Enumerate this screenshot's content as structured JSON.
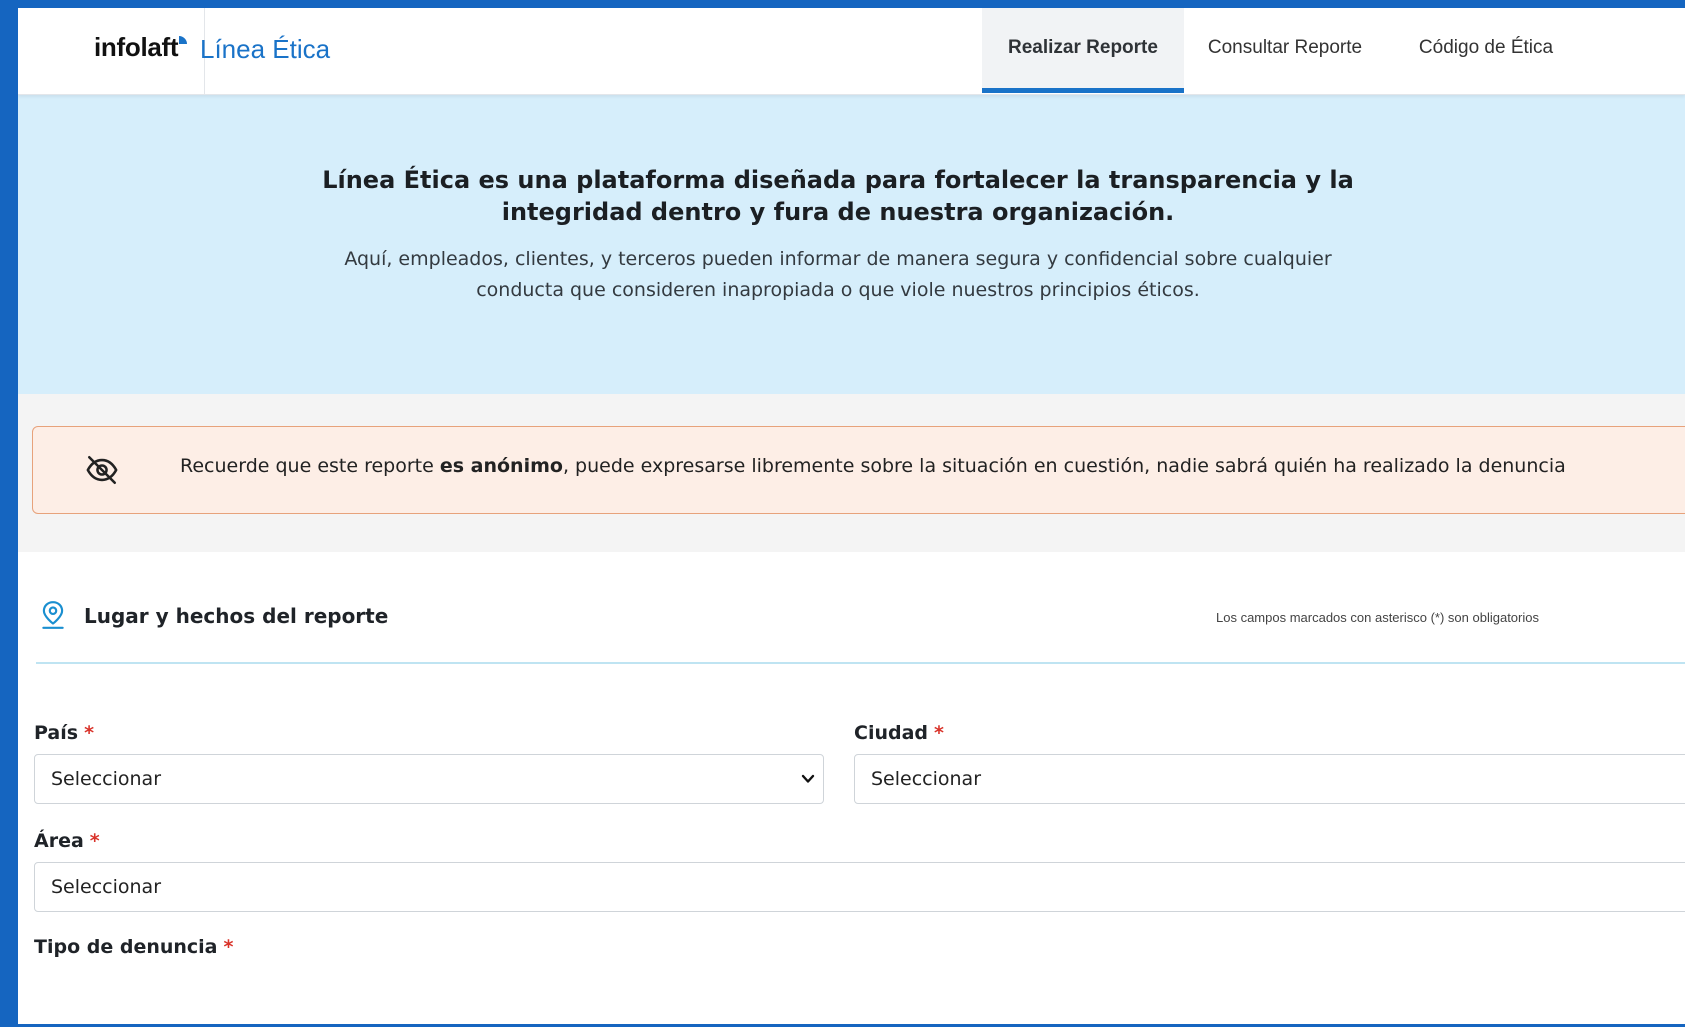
{
  "header": {
    "logo_text": "infolaft",
    "app_title": "Línea Ética",
    "tabs": [
      {
        "label": "Realizar Reporte",
        "active": true
      },
      {
        "label": "Consultar Reporte",
        "active": false
      },
      {
        "label": "Código de Ética",
        "active": false
      }
    ]
  },
  "hero": {
    "title": "Línea Ética es una plataforma diseñada para fortalecer la transparencia y la integridad dentro y fura de nuestra organización.",
    "subtitle": "Aquí, empleados, clientes, y terceros pueden informar de manera segura y confidencial sobre cualquier conducta que consideren inapropiada o que viole nuestros principios éticos."
  },
  "alert": {
    "icon": "eye-off-icon",
    "text_before": "Recuerde que este reporte ",
    "text_bold": "es anónimo",
    "text_after": ", puede expresarse libremente sobre la situación en cuestión, nadie sabrá quién ha realizado la denuncia"
  },
  "section": {
    "icon": "map-pin-icon",
    "title": "Lugar y hechos del reporte",
    "note": "Los campos marcados con asterisco (*) son obligatorios"
  },
  "form": {
    "required_mark": "*",
    "pais": {
      "label": "País",
      "value": "Seleccionar"
    },
    "ciudad": {
      "label": "Ciudad",
      "value": "Seleccionar"
    },
    "area": {
      "label": "Área",
      "value": "Seleccionar"
    },
    "tipo": {
      "label": "Tipo de denuncia"
    }
  },
  "colors": {
    "frame": "#1565c0",
    "accent": "#1a73c8",
    "hero_bg": "#d6eefb",
    "alert_bg": "#fdeee6",
    "alert_border": "#e7a27b",
    "required": "#d9332a"
  }
}
